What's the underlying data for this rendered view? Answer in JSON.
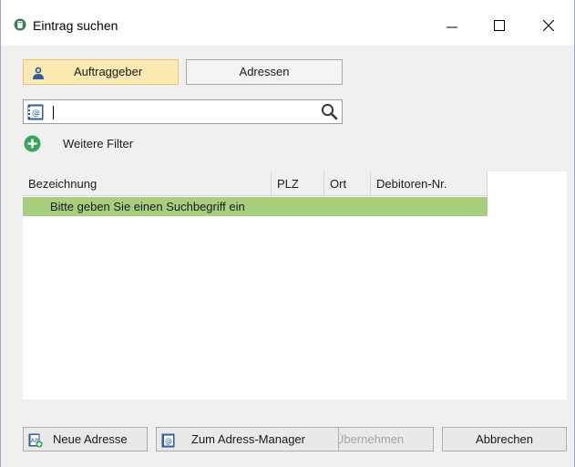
{
  "window": {
    "title": "Eintrag suchen",
    "buttons": {
      "minimize": "minimize-icon",
      "maximize": "maximize-icon",
      "close": "close-icon"
    }
  },
  "tabs": [
    {
      "label": "Auftraggeber",
      "icon": "person-icon",
      "selected": true
    },
    {
      "label": "Adressen",
      "selected": false
    }
  ],
  "search": {
    "value": "",
    "placeholder": "",
    "icon": "address-book-icon"
  },
  "filter": {
    "label": "Weitere Filter",
    "icon": "plus-circle-icon"
  },
  "grid": {
    "columns": [
      "Bezeichnung",
      "PLZ",
      "Ort",
      "Debitoren-Nr."
    ],
    "hint_row": "Bitte geben Sie einen Suchbegriff ein"
  },
  "buttons": {
    "new_address": "Neue Adresse",
    "address_manager": "Zum Adress-Manager",
    "apply": "Übernehmen",
    "cancel": "Abbrechen"
  },
  "colors": {
    "selected_tab": "#fde9b2",
    "hint_row": "#a8cf7e",
    "accent_green": "#3aa35c",
    "icon_blue": "#2f5d9e"
  }
}
